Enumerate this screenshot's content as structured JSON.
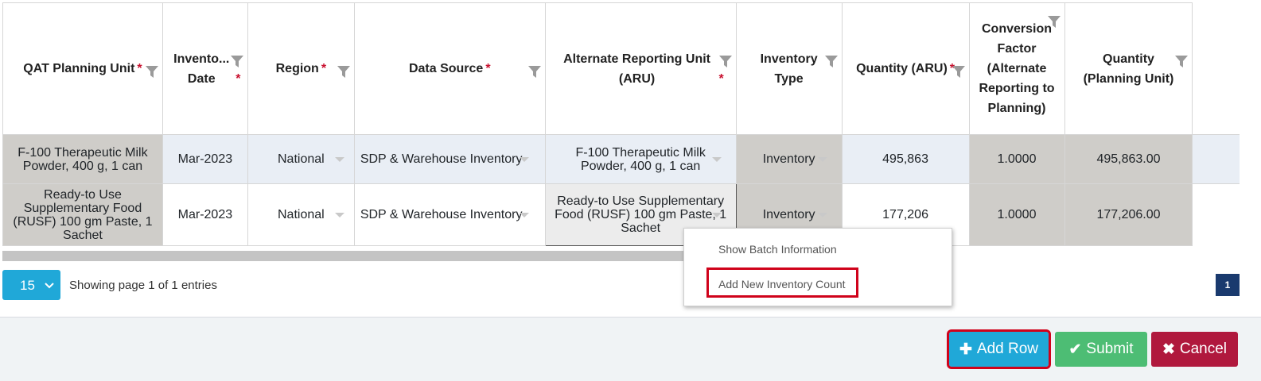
{
  "table": {
    "headers": [
      {
        "label": "QAT Planning Unit",
        "required": "*"
      },
      {
        "label": "Invento... Date",
        "required": "*"
      },
      {
        "label": "Region",
        "required": "*"
      },
      {
        "label": "Data Source",
        "required": "*"
      },
      {
        "label": "Alternate Reporting Unit (ARU)",
        "required": "*"
      },
      {
        "label": "Inventory Type",
        "required": ""
      },
      {
        "label": "Quantity (ARU)",
        "required": "*"
      },
      {
        "label": "Conversion Factor (Alternate Reporting to Planning)",
        "required": ""
      },
      {
        "label": "Quantity (Planning Unit)",
        "required": ""
      }
    ],
    "rows": [
      {
        "planning_unit": "F-100 Therapeutic Milk Powder, 400 g, 1 can",
        "date": "Mar-2023",
        "region": "National",
        "data_source": "SDP & Warehouse Inventory",
        "aru": "F-100 Therapeutic Milk Powder, 400 g, 1 can",
        "inventory_type": "Inventory",
        "quantity_aru": "495,863",
        "conversion_factor": "1.0000",
        "quantity_pu": "495,863.00"
      },
      {
        "planning_unit": "Ready-to Use Supplementary Food (RUSF) 100 gm Paste, 1 Sachet",
        "date": "Mar-2023",
        "region": "National",
        "data_source": "SDP & Warehouse Inventory",
        "aru": "Ready-to Use Supplementary Food (RUSF) 100 gm Paste, 1 Sachet",
        "inventory_type": "Inventory",
        "quantity_aru": "177,206",
        "conversion_factor": "1.0000",
        "quantity_pu": "177,206.00"
      }
    ]
  },
  "pagination": {
    "page_size": "15",
    "info": "Showing page 1 of 1 entries",
    "current_page": "1"
  },
  "context_menu": {
    "items": [
      "Show Batch Information",
      "Add New Inventory Count"
    ]
  },
  "footer": {
    "add_row": "Add Row",
    "submit": "Submit",
    "cancel": "Cancel"
  },
  "colors": {
    "primary": "#20a8d8",
    "success": "#4dbd74",
    "danger": "#b0183d",
    "highlight": "#d0021b",
    "readonly_cell": "#cfcdc9",
    "selected_row": "#e9eef5"
  }
}
